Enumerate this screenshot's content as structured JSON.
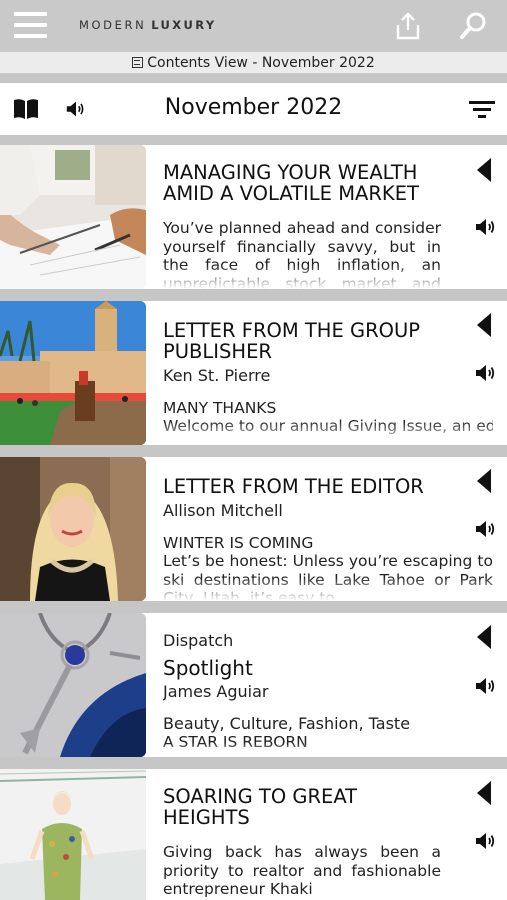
{
  "header": {
    "logo_light": "MODERN",
    "logo_bold": "LUXURY"
  },
  "breadcrumb": {
    "text": "Contents View - November 2022"
  },
  "toolbar": {
    "title": "November 2022"
  },
  "articles": [
    {
      "title": "MANAGING YOUR WEALTH AMID A VOLATILE MARKET",
      "excerpt": "You’ve planned ahead and consider yourself financially savvy, but in the face of high inflation, an unpredictable stock market and rising interest rates"
    },
    {
      "title": "LETTER FROM THE GROUP PUBLISHER",
      "author": "Ken St. Pierre",
      "kicker": "MANY THANKS",
      "excerpt": "Welcome to our annual Giving Issue, an edition that is very special to me"
    },
    {
      "title": "LETTER FROM THE EDITOR",
      "author": "Allison Mitchell",
      "kicker": "WINTER IS COMING",
      "excerpt": "Let’s be honest: Unless you’re escaping to ski destinations like Lake Tahoe or Park City, Utah, it’s easy to"
    },
    {
      "section": "Dispatch",
      "title": "Spotlight",
      "author": "James Aguiar",
      "tags": "Beauty, Culture, Fashion, Taste",
      "kicker": "A STAR IS REBORN"
    },
    {
      "title": "SOARING TO GREAT HEIGHTS",
      "excerpt": "Giving back has always been a priority to realtor and fashionable entrepreneur Khaki"
    }
  ],
  "icons": [
    "menu-icon",
    "share-icon",
    "search-icon",
    "book-icon",
    "speaker-icon",
    "filter-icon",
    "triangle-left-icon"
  ]
}
